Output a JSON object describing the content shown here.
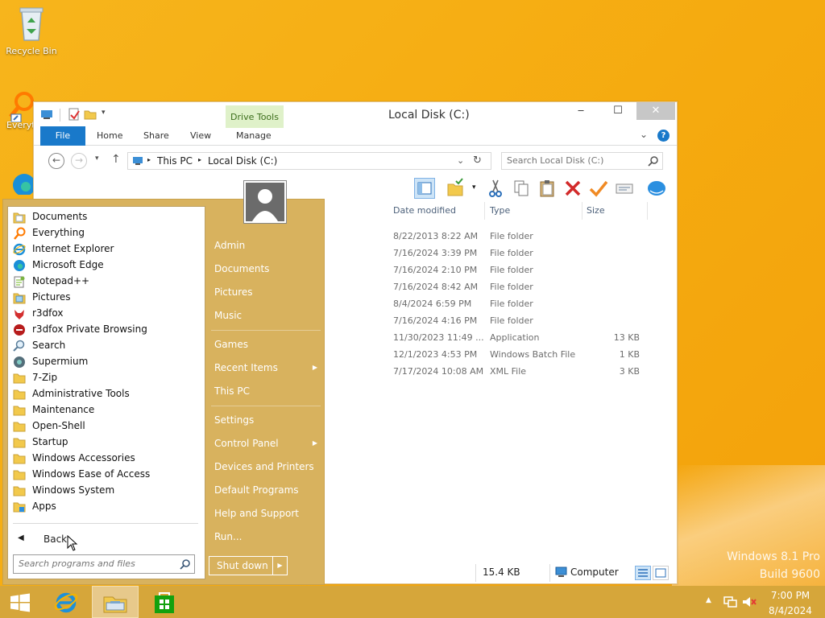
{
  "desktop": {
    "icons": [
      {
        "label": "Recycle Bin"
      },
      {
        "label": "Everyt"
      }
    ],
    "watermark": {
      "line1": "Windows 8.1 Pro",
      "line2": "Build 9600"
    }
  },
  "explorer": {
    "title": "Local Disk (C:)",
    "context_tab": "Drive Tools",
    "ribbon_tabs": {
      "file": "File",
      "home": "Home",
      "share": "Share",
      "view": "View",
      "manage": "Manage"
    },
    "address": {
      "crumb1": "This PC",
      "crumb2": "Local Disk (C:)"
    },
    "search_placeholder": "Search Local Disk (C:)",
    "columns": {
      "date": "Date modified",
      "type": "Type",
      "size": "Size"
    },
    "rows": [
      {
        "date": "8/22/2013 8:22 AM",
        "type": "File folder",
        "size": ""
      },
      {
        "date": "7/16/2024 3:39 PM",
        "type": "File folder",
        "size": ""
      },
      {
        "date": "7/16/2024 2:10 PM",
        "type": "File folder",
        "size": ""
      },
      {
        "date": "7/16/2024 8:42 AM",
        "type": "File folder",
        "size": ""
      },
      {
        "date": "8/4/2024 6:59 PM",
        "type": "File folder",
        "size": ""
      },
      {
        "date": "7/16/2024 4:16 PM",
        "type": "File folder",
        "size": ""
      },
      {
        "date": "11/30/2023 11:49 ...",
        "type": "Application",
        "size": "13 KB"
      },
      {
        "date": "12/1/2023 4:53 PM",
        "type": "Windows Batch File",
        "size": "1 KB"
      },
      {
        "date": "7/17/2024 10:08 AM",
        "type": "XML File",
        "size": "3 KB"
      }
    ],
    "status": {
      "size": "15.4 KB",
      "location": "Computer"
    }
  },
  "start_menu": {
    "programs": [
      {
        "label": "Documents",
        "icon": "documents-icon"
      },
      {
        "label": "Everything",
        "icon": "everything-search-icon"
      },
      {
        "label": "Internet Explorer",
        "icon": "internet-explorer-icon"
      },
      {
        "label": "Microsoft Edge",
        "icon": "edge-icon"
      },
      {
        "label": "Notepad++",
        "icon": "notepad-plus-plus-icon"
      },
      {
        "label": "Pictures",
        "icon": "pictures-icon"
      },
      {
        "label": "r3dfox",
        "icon": "r3dfox-icon"
      },
      {
        "label": "r3dfox Private Browsing",
        "icon": "r3dfox-private-icon"
      },
      {
        "label": "Search",
        "icon": "search-icon"
      },
      {
        "label": "Supermium",
        "icon": "supermium-icon"
      },
      {
        "label": "7-Zip",
        "icon": "folder-icon"
      },
      {
        "label": "Administrative Tools",
        "icon": "folder-icon"
      },
      {
        "label": "Maintenance",
        "icon": "folder-icon"
      },
      {
        "label": "Open-Shell",
        "icon": "folder-icon"
      },
      {
        "label": "Startup",
        "icon": "folder-icon"
      },
      {
        "label": "Windows Accessories",
        "icon": "folder-icon"
      },
      {
        "label": "Windows Ease of Access",
        "icon": "folder-icon"
      },
      {
        "label": "Windows System",
        "icon": "folder-icon"
      },
      {
        "label": "Apps",
        "icon": "apps-folder-icon"
      }
    ],
    "back": "Back",
    "search_placeholder": "Search programs and files",
    "right_items": {
      "admin": "Admin",
      "documents": "Documents",
      "pictures": "Pictures",
      "music": "Music",
      "games": "Games",
      "recent_items": "Recent Items",
      "this_pc": "This PC",
      "settings": "Settings",
      "control_panel": "Control Panel",
      "devices": "Devices and Printers",
      "default_programs": "Default Programs",
      "help": "Help and Support",
      "run": "Run..."
    },
    "shutdown": "Shut down"
  },
  "taskbar": {
    "time": "7:00 PM",
    "date": "8/4/2024"
  },
  "colors": {
    "desktop": "#f5aa0f",
    "start_menu": "#d8b25e",
    "taskbar": "#d6a63a",
    "ribbon_file": "#1979ca",
    "drive_tools": "#dff1c9"
  }
}
